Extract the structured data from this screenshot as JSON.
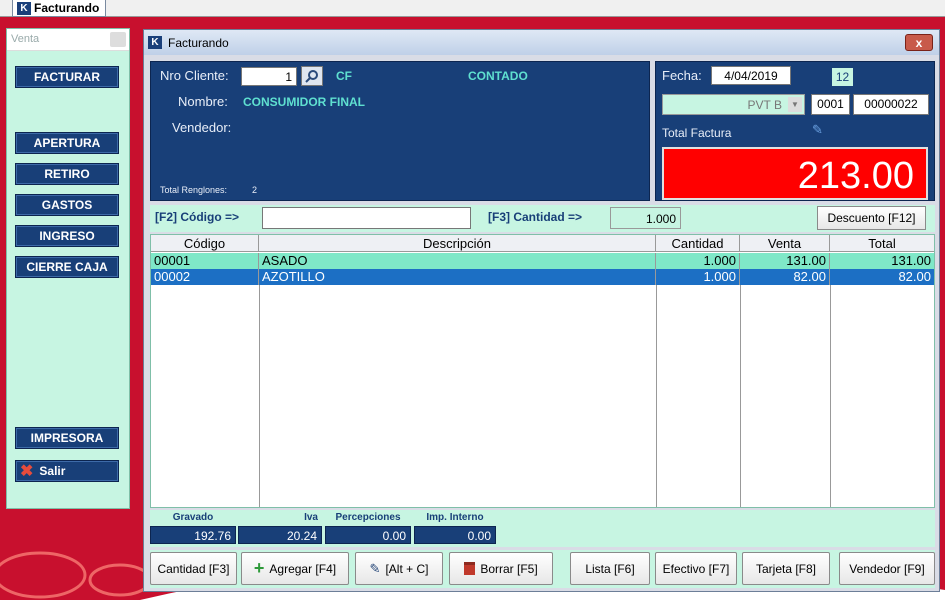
{
  "taskbar": {
    "tab_label": "Facturando"
  },
  "side": {
    "title": "Venta",
    "buttons": {
      "facturar": "FACTURAR",
      "apertura": "APERTURA",
      "retiro": "RETIRO",
      "gastos": "GASTOS",
      "ingreso": "INGRESO",
      "cierre": "CIERRE CAJA",
      "impresora": "IMPRESORA",
      "salir": "Salir"
    }
  },
  "window": {
    "title": "Facturando",
    "close": "x"
  },
  "client": {
    "nro_label": "Nro Cliente:",
    "nro_value": "1",
    "code": "CF",
    "condition": "CONTADO",
    "nombre_label": "Nombre:",
    "nombre_value": "CONSUMIDOR FINAL",
    "vendedor_label": "Vendedor:",
    "renglones_label": "Total Renglones:",
    "renglones_value": "2"
  },
  "invoice": {
    "fecha_label": "Fecha:",
    "fecha_value": "4/04/2019",
    "badge": "12",
    "pvt": "PVT B",
    "punto": "0001",
    "numero": "00000022",
    "total_label": "Total Factura",
    "total_value": "213.00"
  },
  "entry": {
    "codigo_label": "[F2] Código =>",
    "codigo_value": "",
    "cantidad_label": "[F3] Cantidad =>",
    "cantidad_value": "1.000",
    "descuento": "Descuento [F12]"
  },
  "grid": {
    "headers": {
      "codigo": "Código",
      "descripcion": "Descripción",
      "cantidad": "Cantidad",
      "venta": "Venta",
      "total": "Total"
    },
    "rows": [
      {
        "codigo": "00001",
        "descripcion": "ASADO",
        "cantidad": "1.000",
        "venta": "131.00",
        "total": "131.00"
      },
      {
        "codigo": "00002",
        "descripcion": "AZOTILLO",
        "cantidad": "1.000",
        "venta": "82.00",
        "total": "82.00"
      }
    ]
  },
  "totals": {
    "gravado_label": "Gravado",
    "gravado": "192.76",
    "iva_label": "Iva",
    "iva": "20.24",
    "percepciones_label": "Percepciones",
    "percepciones": "0.00",
    "interno_label": "Imp. Interno",
    "interno": "0.00"
  },
  "actions": {
    "cantidad": "Cantidad [F3]",
    "agregar": "Agregar [F4]",
    "altc": "[Alt + C]",
    "borrar": "Borrar [F5]",
    "lista": "Lista [F6]",
    "efectivo": "Efectivo [F7]",
    "tarjeta": "Tarjeta [F8]",
    "vendedor": "Vendedor [F9]"
  },
  "colors": {
    "accent": "#183f78",
    "panel": "#c7f5e2",
    "total_bg": "#ff0000",
    "row_selected": "#1c6fc4",
    "row_normal": "#7fe8c8"
  }
}
